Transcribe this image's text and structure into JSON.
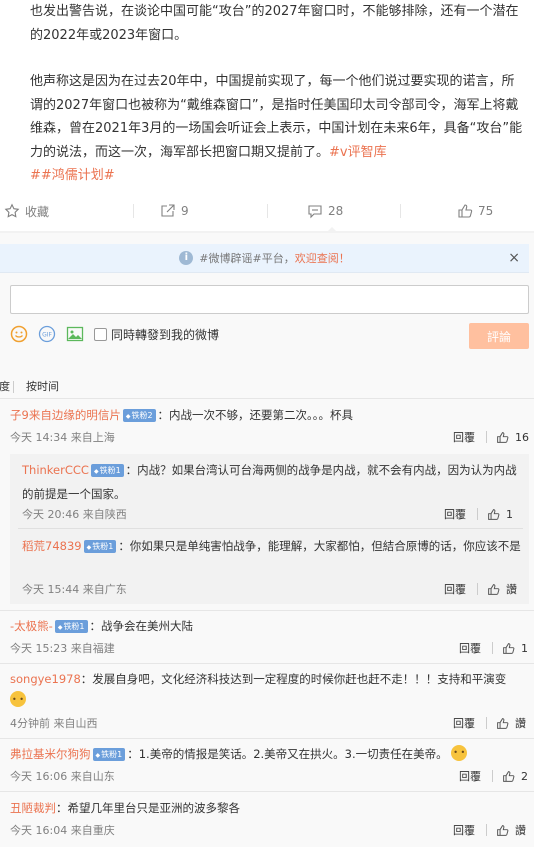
{
  "post": {
    "paragraph1": "也发出警告说，在谈论中国可能“攻台”的2027年窗口时，不能够排除，还有一个潜在的2022年或2023年窗口。",
    "paragraph2": "他声称这是因为在过去20年中，中国提前实现了，每一个他们说过要实现的诺言，所谓的2027年窗口也被称为“戴维森窗口”，是指时任美国印太司令部司令，海军上将戴维森，曾在2021年3月的一场国会听证会上表示，中国计划在未来6年，具备“攻台”能力的说法，而这一次，海军部长把窗口期又提前了。",
    "tag1": "#v评智库",
    "tag2": "##鸿儒计划#"
  },
  "actions": {
    "favorite_label": "收藏",
    "repost_count": "9",
    "comment_count": "28",
    "like_count": "75"
  },
  "notice": {
    "text": "#微博辟谣#平台，",
    "link": "欢迎查阅！",
    "close": "×"
  },
  "composer": {
    "repost_label": "同時轉發到我的微博",
    "submit_label": "評論"
  },
  "sort": {
    "left_label": "度",
    "time_label": "按时间"
  },
  "comments": [
    {
      "user": "子9来自边缘的明信片",
      "badge": "铁粉2",
      "text": "：内战一次不够，还要第二次。。。杯具",
      "time": "今天 14:34 来自上海",
      "reply_label": "回覆",
      "likes": "16"
    },
    {
      "user": "ThinkerCCC",
      "badge": "铁粉1",
      "text": "：内战？如果台湾认可台海两侧的战争是内战，就不会有内战，因为认为内战的前提是一个国家。",
      "time": "今天 20:46 来自陕西",
      "reply_label": "回覆",
      "likes": "1"
    },
    {
      "user": "稻荒74839",
      "badge": "铁粉1",
      "text": "：你如果只是单纯害怕战争，能理解，大家都怕，但結合原博的话，你应该不是",
      "time": "今天 15:44 来自广东",
      "reply_label": "回覆",
      "likes": "讚"
    },
    {
      "user": "-太极熊-",
      "badge": "铁粉1",
      "text": "：战争会在美州大陆",
      "time": "今天 15:23 来自福建",
      "reply_label": "回覆",
      "likes": "1"
    },
    {
      "user": "songye1978",
      "badge": "",
      "text": "：发展自身吧，文化经济科技达到一定程度的时候你赶也赶不走！！！支持和平演变",
      "time": "4分钟前 来自山西",
      "reply_label": "回覆",
      "likes": "讚"
    },
    {
      "user": "弗拉基米尔狗狗",
      "badge": "铁粉1",
      "text": "：1.美帝的情报是笑话。2.美帝又在拱火。3.一切责任在美帝。",
      "time": "今天 16:06 来自山东",
      "reply_label": "回覆",
      "likes": "2"
    },
    {
      "user": "丑陋裁判",
      "badge": "",
      "text": "：希望几年里台只是亚洲的波多黎各",
      "time": "今天 16:04 来自重庆",
      "reply_label": "回覆",
      "likes": "讚"
    }
  ]
}
